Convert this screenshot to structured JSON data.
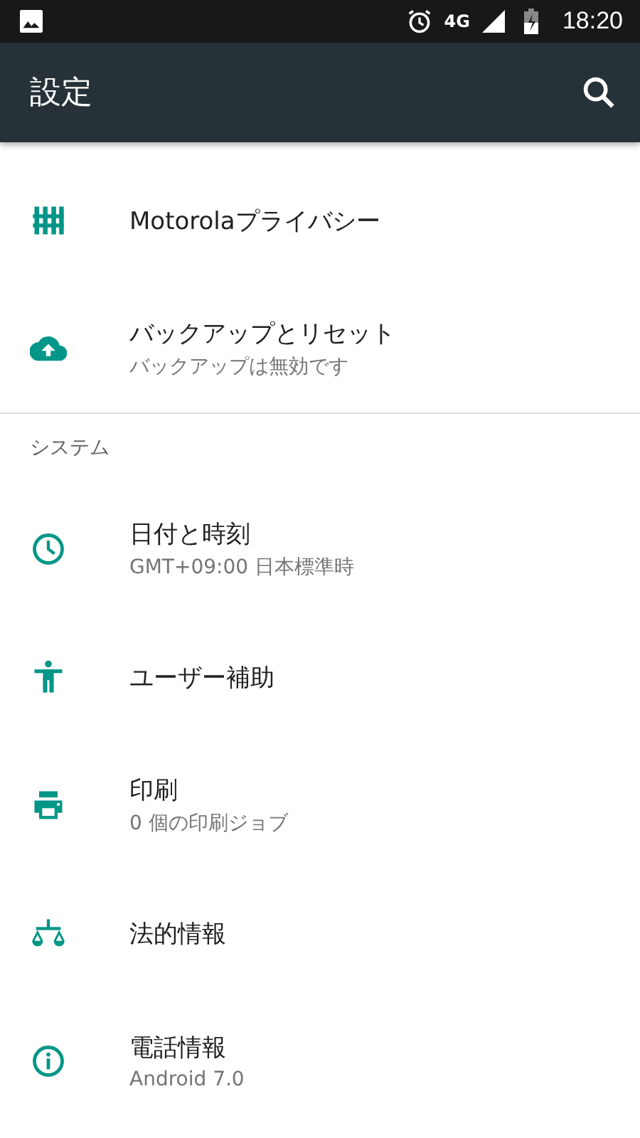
{
  "status_bar": {
    "time": "18:20",
    "network": "4G"
  },
  "app_bar": {
    "title": "設定"
  },
  "sections": [
    {
      "items": [
        {
          "title": "Motorolaプライバシー"
        },
        {
          "title": "バックアップとリセット",
          "subtitle": "バックアップは無効です"
        }
      ]
    },
    {
      "header": "システム",
      "items": [
        {
          "title": "日付と時刻",
          "subtitle": "GMT+09:00 日本標準時"
        },
        {
          "title": "ユーザー補助"
        },
        {
          "title": "印刷",
          "subtitle": "0 個の印刷ジョブ"
        },
        {
          "title": "法的情報"
        },
        {
          "title": "電話情報",
          "subtitle": "Android 7.0"
        }
      ]
    }
  ]
}
